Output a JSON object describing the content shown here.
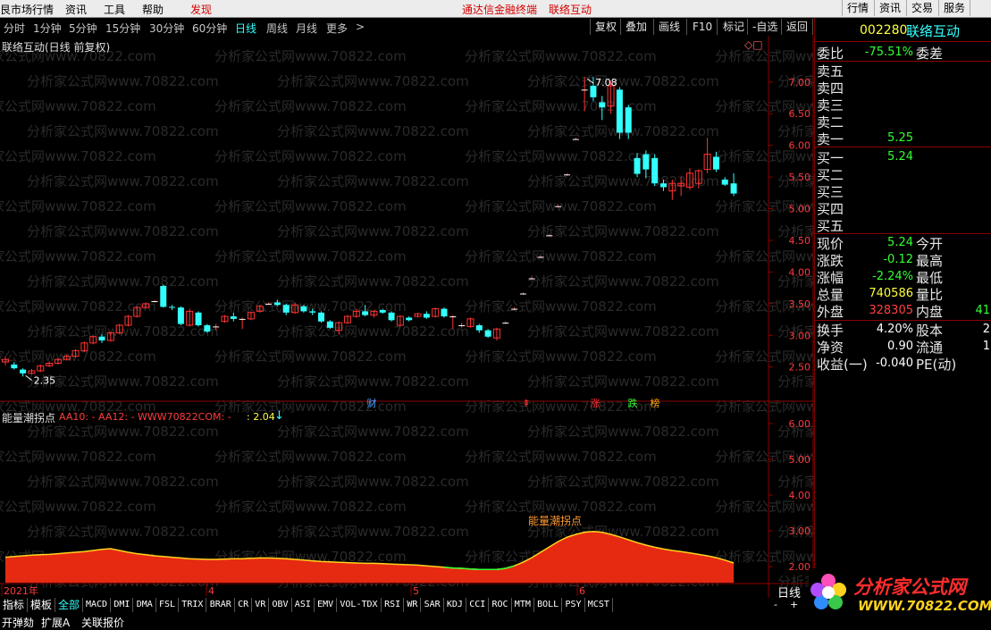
{
  "menubar": {
    "items": [
      "艮市场行情",
      "资讯",
      "工具",
      "帮助"
    ],
    "discover": "发现",
    "center_title": "通达信金融终端",
    "center_stock": "联络互动",
    "right_buttons": [
      "行情",
      "资讯",
      "交易",
      "服务"
    ]
  },
  "periods": [
    "分时",
    "1分钟",
    "5分钟",
    "15分钟",
    "30分钟",
    "60分钟",
    "日线",
    "周线",
    "月线",
    "更多"
  ],
  "more_arrow": ">",
  "toolbar": [
    "复权",
    "叠加",
    "画线",
    "F10",
    "标记",
    "-自选",
    "返回"
  ],
  "chart": {
    "title": "联络互动(日线 前复权)",
    "corner_icons": "◇□",
    "watermark": "分析家公式网www.70822.com",
    "high_label": "7.08",
    "low_label": "2.35",
    "price_axis": [
      "7.00",
      "6.50",
      "6.00",
      "5.50",
      "5.00",
      "4.50",
      "4.00",
      "3.50",
      "3.00",
      "2.50"
    ],
    "price_range": [
      2.2,
      7.35
    ],
    "markers": [
      {
        "text": "财",
        "color": "#4aa0ff"
      },
      {
        "text": "⇞",
        "color": "#ff3333"
      },
      {
        "text": "涨",
        "color": "#ff3333"
      },
      {
        "text": "跌",
        "color": "#33ff33"
      },
      {
        "text": "榜",
        "color": "#ffaa00"
      }
    ],
    "candles": [
      [
        2.58,
        2.62,
        2.53,
        2.67
      ],
      [
        2.54,
        2.48,
        2.46,
        2.58
      ],
      [
        2.46,
        2.4,
        2.35,
        2.48
      ],
      [
        2.4,
        2.44,
        2.38,
        2.47
      ],
      [
        2.44,
        2.52,
        2.42,
        2.54
      ],
      [
        2.52,
        2.56,
        2.5,
        2.59
      ],
      [
        2.56,
        2.62,
        2.54,
        2.64
      ],
      [
        2.62,
        2.67,
        2.6,
        2.7
      ],
      [
        2.67,
        2.76,
        2.65,
        2.78
      ],
      [
        2.76,
        2.88,
        2.74,
        2.9
      ],
      [
        2.88,
        2.98,
        2.86,
        3.0
      ],
      [
        2.98,
        2.92,
        2.88,
        3.02
      ],
      [
        2.92,
        3.04,
        2.9,
        3.06
      ],
      [
        3.04,
        3.16,
        3.02,
        3.18
      ],
      [
        3.16,
        3.3,
        3.14,
        3.32
      ],
      [
        3.3,
        3.44,
        3.28,
        3.46
      ],
      [
        3.44,
        3.5,
        3.42,
        3.52
      ],
      [
        3.54,
        3.54,
        3.52,
        3.56
      ],
      [
        3.78,
        3.45,
        3.44,
        3.8
      ],
      [
        3.45,
        3.44,
        3.4,
        3.48
      ],
      [
        3.44,
        3.18,
        3.16,
        3.46
      ],
      [
        3.16,
        3.38,
        3.14,
        3.42
      ],
      [
        3.36,
        3.16,
        3.14,
        3.38
      ],
      [
        3.16,
        3.06,
        3.04,
        3.18
      ],
      [
        3.14,
        3.14,
        3.08,
        3.18
      ],
      [
        3.22,
        3.3,
        3.2,
        3.32
      ],
      [
        3.3,
        3.26,
        3.22,
        3.36
      ],
      [
        3.26,
        3.26,
        3.1,
        3.28
      ],
      [
        3.26,
        3.36,
        3.24,
        3.38
      ],
      [
        3.38,
        3.46,
        3.36,
        3.48
      ],
      [
        3.5,
        3.5,
        3.48,
        3.52
      ],
      [
        3.52,
        3.48,
        3.46,
        3.56
      ],
      [
        3.48,
        3.36,
        3.32,
        3.5
      ],
      [
        3.36,
        3.48,
        3.34,
        3.52
      ],
      [
        3.46,
        3.38,
        3.36,
        3.48
      ],
      [
        3.38,
        3.36,
        3.32,
        3.42
      ],
      [
        3.36,
        3.22,
        3.2,
        3.38
      ],
      [
        3.22,
        3.12,
        3.1,
        3.24
      ],
      [
        3.08,
        3.2,
        3.02,
        3.22
      ],
      [
        3.2,
        3.3,
        3.18,
        3.32
      ],
      [
        3.3,
        3.38,
        3.28,
        3.42
      ],
      [
        3.38,
        3.32,
        3.3,
        3.48
      ],
      [
        3.32,
        3.38,
        3.28,
        3.4
      ],
      [
        3.4,
        3.36,
        3.34,
        3.42
      ],
      [
        3.36,
        3.24,
        3.22,
        3.38
      ],
      [
        3.16,
        3.3,
        3.14,
        3.32
      ],
      [
        3.28,
        3.24,
        3.22,
        3.3
      ],
      [
        3.3,
        3.34,
        3.28,
        3.36
      ],
      [
        3.34,
        3.28,
        3.26,
        3.38
      ],
      [
        3.3,
        3.42,
        3.28,
        3.44
      ],
      [
        3.42,
        3.3,
        3.28,
        3.44
      ],
      [
        3.3,
        3.3,
        3.1,
        3.32
      ],
      [
        3.16,
        3.16,
        3.12,
        3.2
      ],
      [
        3.14,
        3.26,
        3.12,
        3.28
      ],
      [
        3.16,
        3.08,
        3.04,
        3.18
      ],
      [
        3.08,
        2.98,
        2.96,
        3.1
      ],
      [
        2.96,
        3.1,
        2.92,
        3.12
      ],
      [
        3.2,
        3.2,
        3.18,
        3.22
      ],
      [
        3.42,
        3.42,
        3.4,
        3.44
      ],
      [
        3.66,
        3.66,
        3.64,
        3.68
      ],
      [
        3.9,
        3.9,
        3.88,
        3.92
      ],
      [
        4.24,
        4.24,
        4.22,
        4.26
      ],
      [
        4.58,
        4.58,
        4.56,
        4.6
      ],
      [
        5.04,
        5.04,
        5.02,
        5.06
      ],
      [
        5.54,
        5.54,
        5.52,
        5.56
      ],
      [
        6.1,
        6.1,
        6.08,
        6.12
      ],
      [
        6.88,
        6.88,
        6.54,
        7.08
      ],
      [
        6.94,
        6.76,
        6.7,
        7.08
      ],
      [
        6.68,
        6.6,
        6.4,
        6.78
      ],
      [
        6.62,
        6.94,
        6.5,
        7.02
      ],
      [
        6.88,
        6.2,
        6.1,
        6.92
      ],
      [
        6.6,
        6.2,
        6.1,
        6.64
      ],
      [
        5.8,
        5.55,
        5.5,
        5.88
      ],
      [
        5.86,
        5.62,
        5.48,
        5.92
      ],
      [
        5.8,
        5.4,
        5.36,
        5.86
      ],
      [
        5.4,
        5.34,
        5.28,
        5.46
      ],
      [
        5.28,
        5.4,
        5.14,
        5.46
      ],
      [
        5.36,
        5.4,
        5.2,
        5.5
      ],
      [
        5.34,
        5.56,
        5.3,
        5.64
      ],
      [
        5.4,
        5.6,
        5.32,
        5.62
      ],
      [
        5.62,
        5.86,
        5.56,
        6.12
      ],
      [
        5.82,
        5.62,
        5.58,
        5.9
      ],
      [
        5.46,
        5.38,
        5.36,
        5.5
      ],
      [
        5.4,
        5.24,
        5.2,
        5.56
      ]
    ],
    "indicator_title": "能量潮拐点",
    "indicator_params": "AA10: - AA12: - WWW70822COM: -",
    "indicator_value": ": 2.04",
    "indicator_arrow": "↓",
    "indicator_label": "能量潮拐点",
    "indicator_axis": [
      "6.00",
      "5.00",
      "4.00",
      "3.00",
      "2.00"
    ],
    "indicator_range": [
      1.55,
      6.45
    ],
    "indicator_values": [
      2.26,
      2.28,
      2.3,
      2.32,
      2.33,
      2.34,
      2.36,
      2.38,
      2.4,
      2.42,
      2.45,
      2.48,
      2.5,
      2.45,
      2.4,
      2.36,
      2.33,
      2.3,
      2.28,
      2.26,
      2.24,
      2.22,
      2.21,
      2.2,
      2.2,
      2.21,
      2.22,
      2.22,
      2.23,
      2.24,
      2.24,
      2.23,
      2.22,
      2.2,
      2.18,
      2.16,
      2.14,
      2.13,
      2.12,
      2.11,
      2.1,
      2.09,
      2.09,
      2.08,
      2.07,
      2.06,
      2.05,
      2.04,
      2.02,
      2.0,
      1.98,
      1.96,
      1.95,
      1.93,
      1.92,
      1.92,
      1.92,
      1.95,
      2.02,
      2.12,
      2.25,
      2.4,
      2.55,
      2.7,
      2.82,
      2.9,
      2.96,
      2.98,
      2.96,
      2.9,
      2.83,
      2.75,
      2.67,
      2.6,
      2.54,
      2.49,
      2.45,
      2.42,
      2.38,
      2.34,
      2.3,
      2.25,
      2.18,
      2.1
    ],
    "date_labels": [
      "2021年",
      "4",
      "5",
      "6"
    ]
  },
  "quote": {
    "code": "002280",
    "name": "联络互动",
    "weibi_label": "委比",
    "weibi_value": "-75.51%",
    "weicha_label": "委差",
    "sell_labels": [
      "卖五",
      "卖四",
      "卖三",
      "卖二",
      "卖一"
    ],
    "sell1_price": "5.25",
    "buy_labels": [
      "买一",
      "买二",
      "买三",
      "买四",
      "买五"
    ],
    "buy1_price": "5.24",
    "rows": [
      {
        "l": "现价",
        "v": "5.24",
        "c": "#33ff33",
        "l2": "今开",
        "v2": ""
      },
      {
        "l": "涨跌",
        "v": "-0.12",
        "c": "#33ff33",
        "l2": "最高",
        "v2": ""
      },
      {
        "l": "涨幅",
        "v": "-2.24%",
        "c": "#33ff33",
        "l2": "最低",
        "v2": ""
      },
      {
        "l": "总量",
        "v": "740586",
        "c": "#ffff33",
        "l2": "量比",
        "v2": ""
      },
      {
        "l": "外盘",
        "v": "328305",
        "c": "#ff4040",
        "l2": "内盘",
        "v2": "41"
      }
    ],
    "rows2": [
      {
        "l": "换手",
        "v": "4.20%",
        "c": "#ffffff",
        "l2": "股本",
        "v2": "2"
      },
      {
        "l": "净资",
        "v": "0.90",
        "c": "#ffffff",
        "l2": "流通",
        "v2": "1"
      },
      {
        "l": "收益(一)",
        "v": "-0.040",
        "c": "#ffffff",
        "l2": "PE(动)",
        "v2": ""
      }
    ]
  },
  "right_bottom": {
    "period": "日线",
    "minus": "-",
    "plus": "+"
  },
  "tabs": [
    "指标",
    "模板",
    "全部",
    "MACD",
    "DMI",
    "DMA",
    "FSL",
    "TRIX",
    "BRAR",
    "CR",
    "VR",
    "OBV",
    "ASI",
    "EMV",
    "VOL-TDX",
    "RSI",
    "WR",
    "SAR",
    "KDJ",
    "CCI",
    "ROC",
    "MTM",
    "BOLL",
    "PSY",
    "MCST"
  ],
  "bottom_row": [
    "开弹劾",
    "扩展A",
    "关联报价"
  ],
  "logo": {
    "text": "分析家公式网",
    "url": "WWW.70822.COM"
  },
  "colors": {
    "up": "#ff3333",
    "down": "#33ffff",
    "axis": "#8b0000",
    "grid_text": "#ff3c3c"
  }
}
